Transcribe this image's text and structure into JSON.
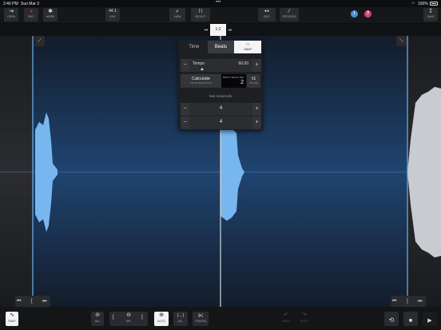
{
  "status": {
    "time": "2:40 PM",
    "date": "Sun Mar 3",
    "dots": "•••",
    "battery": "100%"
  },
  "toolbar": {
    "open": {
      "icon": "⇥",
      "label": "OPEN"
    },
    "rec": {
      "icon": "●",
      "label": "REC"
    },
    "more": {
      "icon": "✱",
      "label": "MORE"
    },
    "rate": {
      "icon": "44.1",
      "label": "KHZ"
    },
    "view": {
      "icon": "⌕",
      "label": "VIEW"
    },
    "select": {
      "icon": "[·]",
      "label": "SELECT"
    },
    "edit": {
      "icon": "●●",
      "label": "EDIT"
    },
    "process": {
      "icon": "⁄",
      "label": "PROCESS"
    },
    "save": {
      "icon": "↧",
      "label": "SAVE"
    },
    "info_icon": "i",
    "help_icon": "?"
  },
  "pager": {
    "prev": "⏮",
    "page": "1:2",
    "next": "⏭"
  },
  "popover": {
    "tabs": {
      "time": "Time",
      "beats": "Beats",
      "snap_icon": "∩",
      "snap": "SNAP"
    },
    "tempo": {
      "label": "Tempo",
      "value": "60.00",
      "minus": "−",
      "plus": "+"
    },
    "calculate": {
      "title": "Calculate",
      "subtitle": "FROM SELECTION"
    },
    "beats_selected": {
      "label": "BEATS SELECTED",
      "value": "2"
    },
    "round": {
      "title": "±1",
      "subtitle": "ROUND"
    },
    "time_signature": {
      "label": "TIME SIGNATURE",
      "top": "4",
      "bottom": "4",
      "minus": "−",
      "plus": "+"
    }
  },
  "corners": {
    "left_icon": "⟋",
    "right_icon": "⟍"
  },
  "transport_left": {
    "start": "⏮",
    "bracket": "[",
    "end": "⏭"
  },
  "transport_right": {
    "start": "⏮",
    "bracket": "]",
    "end": "⏭"
  },
  "bottom": {
    "snap": {
      "icon": "∿",
      "label": "SNAP"
    },
    "zoom_all": {
      "icon": "⊖",
      "label": "ALL"
    },
    "bracket_left": "[",
    "zoom_sel": {
      "icon": "⊖",
      "label": "SEL"
    },
    "bracket_right": "]",
    "auto": {
      "icon": "⊕",
      "label": "AUTO"
    },
    "all_sel": {
      "icon": "[↔]",
      "label": "ALL"
    },
    "tracks": {
      "icon": "[▸]",
      "label": "TRACKS"
    },
    "undo": {
      "icon": "↶",
      "label": "UNDO"
    },
    "redo": {
      "icon": "↷",
      "label": "REDO"
    },
    "loop_icon": "⟲",
    "stop_icon": "■",
    "play_icon": "▶"
  },
  "colors": {
    "accent": "#6fb3ef",
    "waveform": "#78b6f0",
    "selection_bg": "#1c3656",
    "record": "#c32424",
    "info": "#4a90d9",
    "help": "#d9437f"
  }
}
